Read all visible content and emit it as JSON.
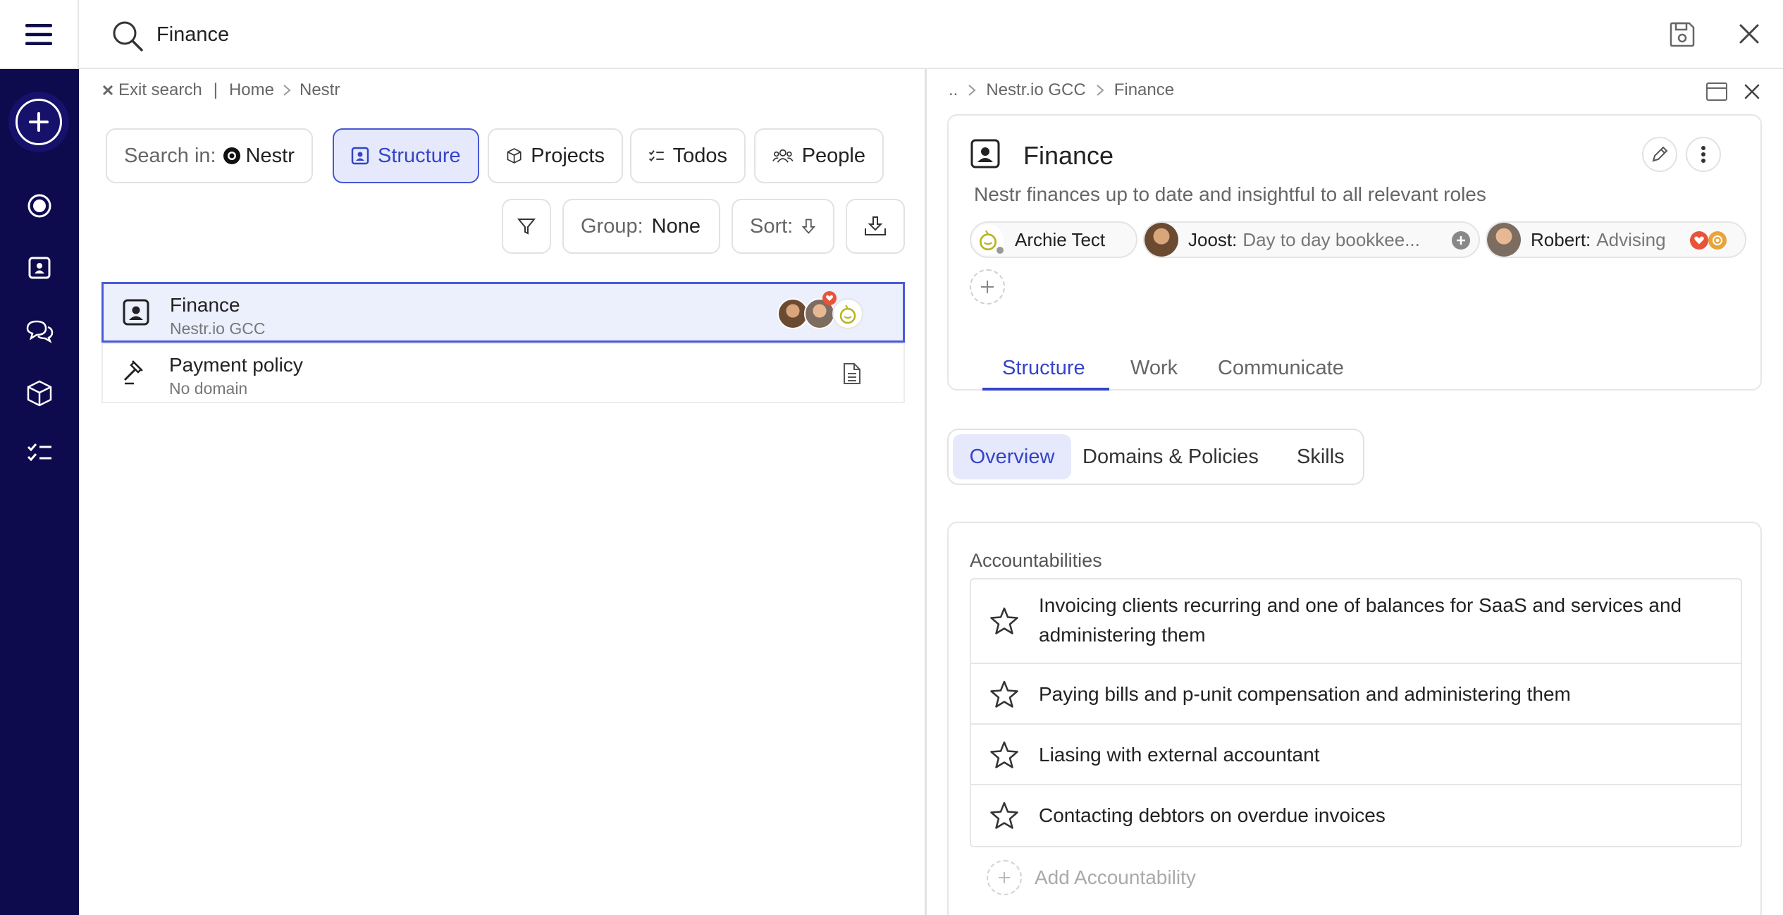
{
  "search": {
    "value": "Finance"
  },
  "left": {
    "breadcrumb": {
      "exit": "Exit search",
      "separator": "|",
      "home": "Home",
      "current": "Nestr"
    },
    "search_in": {
      "label": "Search in:",
      "value": "Nestr"
    },
    "filters": [
      {
        "label": "Structure",
        "active": true
      },
      {
        "label": "Projects",
        "active": false
      },
      {
        "label": "Todos",
        "active": false
      },
      {
        "label": "People",
        "active": false
      }
    ],
    "group": {
      "label": "Group:",
      "value": "None"
    },
    "sort": {
      "label": "Sort:"
    },
    "results": [
      {
        "title": "Finance",
        "subtitle": "Nestr.io GCC",
        "icon": "role-badge-icon"
      },
      {
        "title": "Payment policy",
        "subtitle": "No domain",
        "icon": "gavel-icon"
      }
    ]
  },
  "right": {
    "breadcrumb": {
      "up": "..",
      "parent": "Nestr.io GCC",
      "current": "Finance"
    },
    "title": "Finance",
    "purpose": "Nestr finances up to date and insightful to all relevant roles",
    "assignees": [
      {
        "name": "Archie Tect",
        "focus": ""
      },
      {
        "name": "Joost",
        "focus": "Day to day bookkee..."
      },
      {
        "name": "Robert",
        "focus": "Advising"
      }
    ],
    "tabs": [
      "Structure",
      "Work",
      "Communicate"
    ],
    "subtabs": [
      "Overview",
      "Domains & Policies",
      "Skills"
    ],
    "accountabilities_title": "Accountabilities",
    "accountabilities": [
      "Invoicing clients recurring and one of balances for SaaS and services and administering them",
      "Paying bills and p-unit compensation and administering them",
      "Liasing with external accountant",
      "Contacting debtors on overdue invoices"
    ],
    "add_accountability": "Add Accountability"
  },
  "colors": {
    "sidebar": "#0d0a4d",
    "accent": "#3544c8",
    "selected_bg": "#eceffc"
  }
}
